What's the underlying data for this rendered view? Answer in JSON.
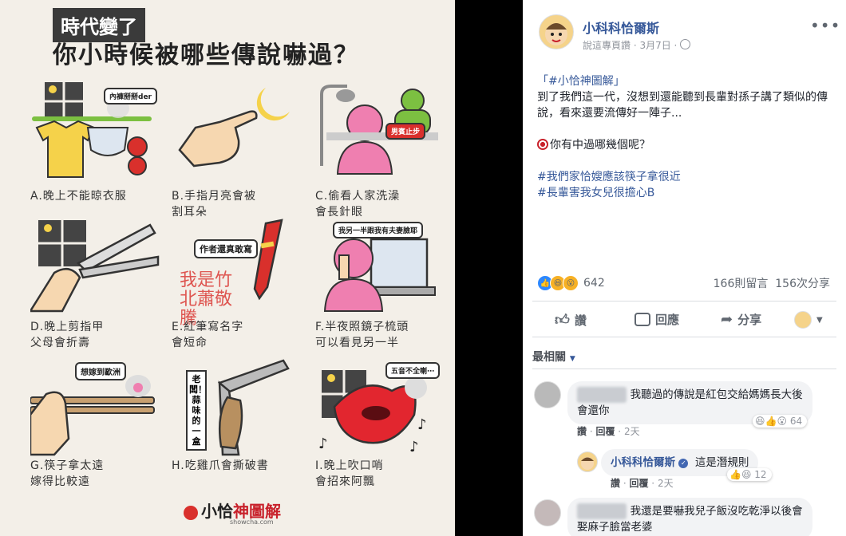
{
  "poster": {
    "tag": "時代變了",
    "title": "你小時候被哪些傳說嚇過？",
    "items": [
      {
        "caption": "A.晚上不能晾衣服",
        "bubble": "內褲掰掰der"
      },
      {
        "caption": "B.手指月亮會被\n割耳朵",
        "bubble": ""
      },
      {
        "caption": "C.偷看人家洗澡\n會長針眼",
        "bubble": "男賓止步"
      },
      {
        "caption": "D.晚上剪指甲\n父母會折壽",
        "bubble": ""
      },
      {
        "caption": "E.紅筆寫名字\n會短命",
        "bubble": "作者還真敢寫"
      },
      {
        "caption": "F.半夜照鏡子梳頭\n可以看見另一半",
        "bubble": "我另一半跟我有夫妻臉耶"
      },
      {
        "caption": "G.筷子拿太遠\n嫁得比較遠",
        "bubble": "想嫁到歐洲"
      },
      {
        "caption": "H.吃雞爪會撕破書",
        "bubble": "老闆！蒜味的一盒"
      },
      {
        "caption": "I.晚上吹口哨\n會招來阿飄",
        "bubble": "五音不全喇⋯"
      }
    ],
    "red_text": "我是竹北蕭敬騰",
    "logo_black": "小恰",
    "logo_red": "神圖解",
    "logo_sub": "showcha.com"
  },
  "post": {
    "page_name": "小科科恰爾斯",
    "meta": "說這專頁讚 · 3月7日 ·",
    "line1_tag": "「#小恰神圖解」",
    "line2": "到了我們這一代，沒想到還能聽到長輩對孫子講了類似的傳說，看來還要流傳好一陣子...",
    "line3": "你有中過哪幾個呢？",
    "hashtag1": "#我們家恰嫂應該筷子拿很近",
    "hashtag2": "#長輩害我女兒很擔心B",
    "reaction_count": "642",
    "comments_count": "166則留言",
    "shares_count": "156次分享"
  },
  "actions": {
    "like": "讚",
    "comment": "回應",
    "share": "分享"
  },
  "sort_label": "最相關",
  "comments": [
    {
      "text": "我聽過的傳說是紅包交給媽媽長大後會還你",
      "like": "讚",
      "reply": "回覆",
      "time": "2天",
      "reactions": "64"
    },
    {
      "author": "小科科恰爾斯",
      "text": "這是潛規則",
      "like": "讚",
      "reply": "回覆",
      "time": "2天",
      "reactions": "12"
    },
    {
      "text": "我還是要嚇我兒子飯沒吃乾淨以後會娶麻子臉當老婆"
    }
  ],
  "colors": {
    "link": "#365899",
    "poster_bg": "#f3efe8",
    "red": "#c8202a",
    "pink": "#ef7fb0"
  }
}
